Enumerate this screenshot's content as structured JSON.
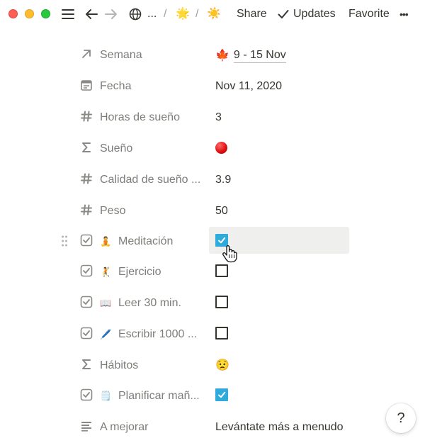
{
  "topbar": {
    "breadcrumb_ellipsis": "...",
    "crumb_emoji_1": "🌟",
    "crumb_emoji_2": "☀️",
    "separator": "/",
    "share_label": "Share",
    "updates_label": "Updates",
    "favorite_label": "Favorite",
    "more_label": "•••"
  },
  "properties": [
    {
      "label": "Semana",
      "icon": "arrow-up-right-icon",
      "value_emoji": "🍁",
      "value": "9 - 15 Nov"
    },
    {
      "label": "Fecha",
      "icon": "calendar-icon",
      "value": "Nov 11, 2020"
    },
    {
      "label": "Horas de sueño",
      "icon": "number-icon",
      "value": "3"
    },
    {
      "label": "Sueño",
      "icon": "formula-icon",
      "value_emoji": "red-circle"
    },
    {
      "label": "Calidad de sueño ...",
      "icon": "number-icon",
      "value": "3.9"
    },
    {
      "label": "Peso",
      "icon": "number-icon",
      "value": "50"
    },
    {
      "label": "Meditación",
      "icon": "checkbox-icon",
      "label_emoji": "🧘",
      "checked": true
    },
    {
      "label": "Ejercicio",
      "icon": "checkbox-icon",
      "label_emoji": "🤾",
      "checked": false
    },
    {
      "label": "Leer 30 min.",
      "icon": "checkbox-icon",
      "label_emoji": "📖",
      "checked": false
    },
    {
      "label": "Escribir 1000 ...",
      "icon": "checkbox-icon",
      "label_emoji": "🖊️",
      "checked": false
    },
    {
      "label": "Hábitos",
      "icon": "formula-icon",
      "value_emoji": "😟"
    },
    {
      "label": "Planificar mañ...",
      "icon": "checkbox-icon",
      "label_emoji": "🗒️",
      "checked": true
    },
    {
      "label": "A mejorar",
      "icon": "text-icon",
      "value": "Levántate más a menudo"
    }
  ],
  "help_label": "?",
  "colors": {
    "checkbox_checked": "#2eaadc",
    "label_gray": "#8a8986",
    "text": "#37352f"
  }
}
